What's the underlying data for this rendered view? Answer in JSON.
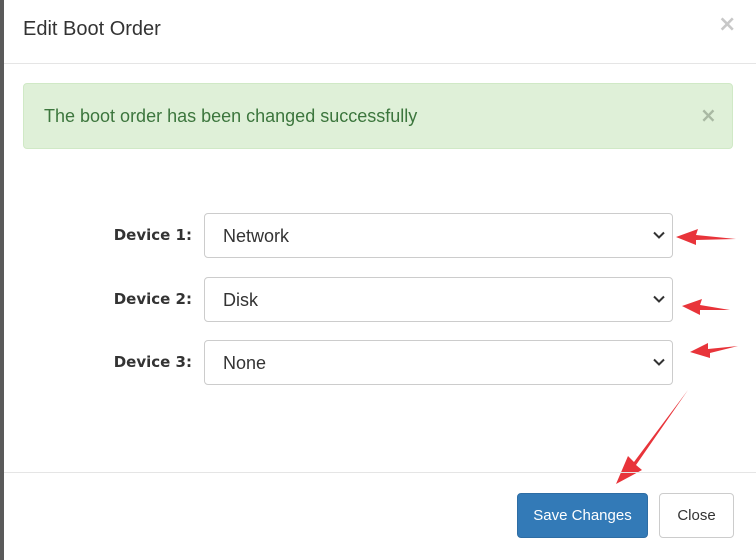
{
  "modal": {
    "title": "Edit Boot Order",
    "close_glyph": "×"
  },
  "alert": {
    "message": "The boot order has been changed successfully",
    "close_glyph": "×",
    "color": "#3c763d"
  },
  "form": {
    "devices": [
      {
        "label": "Device 1:",
        "value": "Network"
      },
      {
        "label": "Device 2:",
        "value": "Disk"
      },
      {
        "label": "Device 3:",
        "value": "None"
      }
    ]
  },
  "footer": {
    "save_label": "Save Changes",
    "close_label": "Close"
  },
  "colors": {
    "primary": "#337ab7",
    "annotation": "#e8343a",
    "success_bg": "#dff0d8"
  },
  "icons": {
    "select": "chevron-down-icon",
    "close": "close-icon",
    "annotation": "red-arrow-icon"
  }
}
